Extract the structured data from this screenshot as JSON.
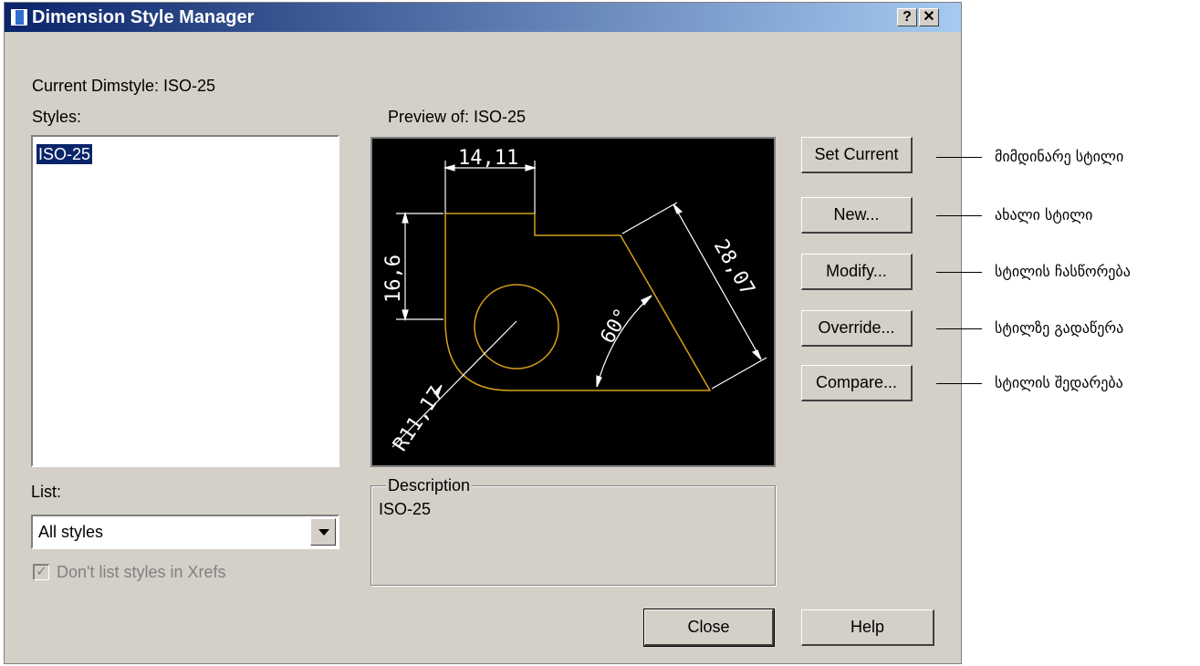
{
  "window": {
    "title": "Dimension Style Manager",
    "help_glyph": "?",
    "close_glyph": "✕"
  },
  "current_label": "Current Dimstyle: ISO-25",
  "styles": {
    "label": "Styles:",
    "items": [
      "ISO-25"
    ]
  },
  "preview": {
    "label": "Preview of: ISO-25",
    "dims": {
      "top": "14,11",
      "left": "16,6",
      "slant": "28,07",
      "angle": "60°",
      "radius": "R11,17"
    },
    "colors": {
      "geometry": "#d4a017",
      "dimensions": "#ffffff",
      "background": "#000000"
    }
  },
  "buttons": {
    "set_current": "Set Current",
    "new": "New...",
    "modify": "Modify...",
    "override": "Override...",
    "compare": "Compare...",
    "close": "Close",
    "help": "Help"
  },
  "list": {
    "label": "List:",
    "selected": "All styles",
    "checkbox_label": "Don't list styles in Xrefs",
    "checkbox_checked": true
  },
  "description": {
    "title": "Description",
    "text": "ISO-25"
  },
  "annotations": {
    "set_current": "მიმდინარე სტილი",
    "new": "ახალი სტილი",
    "modify": "სტილის ჩასწორება",
    "override": "სტილზე გადაწერა",
    "compare": "სტილის შედარება"
  }
}
